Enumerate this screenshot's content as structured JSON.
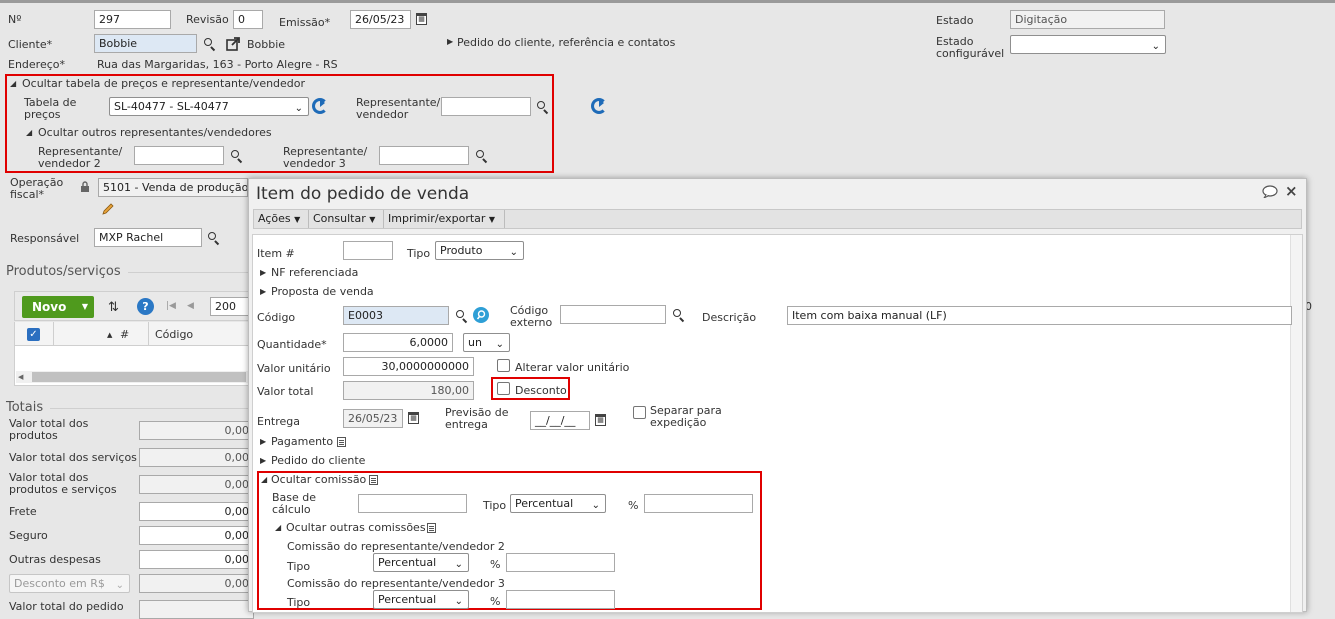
{
  "header": {
    "numero_label": "Nº",
    "numero_value": "297",
    "revisao_label": "Revisão",
    "revisao_value": "0",
    "emissao_label": "Emissão*",
    "emissao_value": "26/05/23",
    "cliente_label": "Cliente*",
    "cliente_value": "Bobbie",
    "cliente_link": "Bobbie",
    "pedido_cliente_label": "Pedido do cliente, referência e contatos",
    "endereco_label": "Endereço*",
    "endereco_value": "Rua das Margaridas, 163 - Porto Alegre - RS",
    "estado_label": "Estado",
    "estado_value": "Digitação",
    "estado_conf_label_1": "Estado",
    "estado_conf_label_2": "configurável",
    "estado_conf_value": ""
  },
  "precos": {
    "toggle_label": "Ocultar tabela de preços e representante/vendedor",
    "tabela_label_1": "Tabela de",
    "tabela_label_2": "preços",
    "tabela_value": "SL-40477 - SL-40477",
    "rep_label_1": "Representante/",
    "rep_label_2": "vendedor",
    "rep_value": "",
    "outros_toggle": "Ocultar outros representantes/vendedores",
    "rep2_label_1": "Representante/",
    "rep2_label_2": "vendedor 2",
    "rep2_value": "",
    "rep3_label_1": "Representante/",
    "rep3_label_2": "vendedor 3",
    "rep3_value": ""
  },
  "fiscal": {
    "operacao_label_1": "Operação",
    "operacao_label_2": "fiscal*",
    "operacao_value": "5101 - Venda de produção",
    "responsavel_label": "Responsável",
    "responsavel_value": "MXP Rachel"
  },
  "produtos": {
    "title": "Produtos/serviços",
    "novo_label": "Novo",
    "page_value": "200",
    "right_num": "0",
    "col_num": "#",
    "col_codigo": "Código"
  },
  "totais": {
    "title": "Totais",
    "rows": [
      {
        "label1": "Valor total dos",
        "label2": "produtos",
        "value": "0,00"
      },
      {
        "label1": "Valor total dos serviços",
        "label2": "",
        "value": "0,00"
      },
      {
        "label1": "Valor total dos",
        "label2": "produtos e serviços",
        "value": "0,00"
      },
      {
        "label1": "Frete",
        "label2": "",
        "value": "0,00"
      },
      {
        "label1": "Seguro",
        "label2": "",
        "value": "0,00"
      },
      {
        "label1": "Outras despesas",
        "label2": "",
        "value": "0,00"
      }
    ],
    "desconto_select": "Desconto em R$",
    "desconto_value": "0,00",
    "pedido_label": "Valor total do pedido"
  },
  "modal": {
    "title": "Item do pedido de venda",
    "menus": [
      "Ações",
      "Consultar",
      "Imprimir/exportar"
    ],
    "item_label": "Item #",
    "item_value": "",
    "tipo_label": "Tipo",
    "tipo_value": "Produto",
    "nf_ref": "NF referenciada",
    "proposta": "Proposta de venda",
    "codigo_label": "Código",
    "codigo_value": "E0003",
    "cod_ext_label_1": "Código",
    "cod_ext_label_2": "externo",
    "cod_ext_value": "",
    "descricao_label": "Descrição",
    "descricao_value": "Item com baixa manual (LF)",
    "quantidade_label": "Quantidade*",
    "quantidade_value": "6,0000",
    "unidade_value": "un",
    "valor_unit_label": "Valor unitário",
    "valor_unit_value": "30,0000000000",
    "alterar_label": "Alterar valor unitário",
    "valor_total_label": "Valor total",
    "valor_total_value": "180,00",
    "desconto_label": "Desconto",
    "entrega_label": "Entrega",
    "entrega_value": "26/05/23",
    "previsao_label_1": "Previsão de",
    "previsao_label_2": "entrega",
    "previsao_value": "__/__/__",
    "separar_label_1": "Separar para",
    "separar_label_2": "expedição",
    "pagamento": "Pagamento",
    "pedido_cliente": "Pedido do cliente",
    "comissao_toggle": "Ocultar comissão",
    "base_label_1": "Base de",
    "base_label_2": "cálculo",
    "base_value": "",
    "com_tipo_label": "Tipo",
    "com_tipo_value": "Percentual",
    "pct_label": "%",
    "pct_value": "",
    "outras_com_toggle": "Ocultar outras comissões",
    "com2_title": "Comissão do representante/vendedor 2",
    "com2_tipo_label": "Tipo",
    "com2_tipo_value": "Percentual",
    "com2_pct_label": "%",
    "com2_pct_value": "",
    "com3_title": "Comissão do representante/vendedor 3",
    "com3_tipo_label": "Tipo",
    "com3_tipo_value": "Percentual",
    "com3_pct_label": "%",
    "com3_pct_value": ""
  },
  "colors": {
    "highlight": "#e00000",
    "accent_blue": "#1e6bb8",
    "novo_green": "#4f9a1d"
  }
}
